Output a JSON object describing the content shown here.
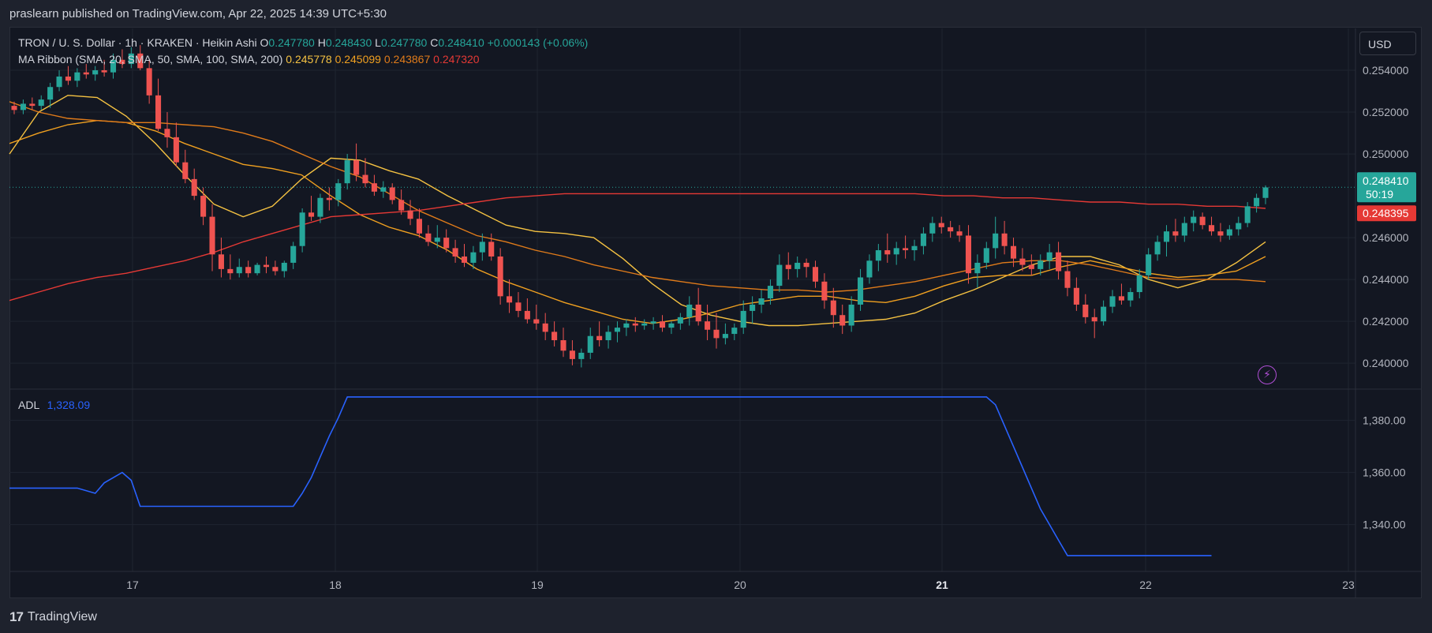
{
  "header": {
    "publisher_text": "praslearn published on TradingView.com, Apr 22, 2025 14:39 UTC+5:30"
  },
  "legend": {
    "symbol": "TRON / U. S. Dollar · 1h · KRAKEN · Heikin Ashi",
    "o_label": "O",
    "o_value": "0.247780",
    "h_label": "H",
    "h_value": "0.248430",
    "l_label": "L",
    "l_value": "0.247780",
    "c_label": "C",
    "c_value": "0.248410",
    "change": "+0.000143 (+0.06%)",
    "ma_title": "MA Ribbon (SMA, 20, SMA, 50, SMA, 100, SMA, 200)",
    "ma_values": [
      "0.245778",
      "0.245099",
      "0.243867",
      "0.247320"
    ],
    "adl_label": "ADL",
    "adl_value": "1,328.09"
  },
  "toolbar": {
    "currency_label": "USD"
  },
  "footer": {
    "brand_mark": "17",
    "brand_name": "TradingView"
  },
  "icons": {
    "bolt": "lightning-bolt-icon"
  },
  "colors": {
    "up": "#26a69a",
    "down": "#ef5350",
    "sma20": "#f5c242",
    "sma50": "#f0a020",
    "sma100": "#e07b1a",
    "sma200": "#e53935",
    "adl": "#2962ff"
  },
  "chart_data": [
    {
      "type": "candlestick",
      "title": "TRON / U. S. Dollar · 1h · KRAKEN · Heikin Ashi",
      "x_ticks": [
        "17",
        "18",
        "19",
        "20",
        "21",
        "22",
        "23"
      ],
      "y_ticks": [
        "0.254000",
        "0.252000",
        "0.250000",
        "0.246000",
        "0.244000",
        "0.242000",
        "0.240000"
      ],
      "ylim": [
        0.2388,
        0.256
      ],
      "price_label": "0.248410",
      "countdown_label": "50:19",
      "sma200_label": "0.248395",
      "last_price": 0.24841,
      "candles": [
        [
          0.2523,
          0.2525,
          0.2519,
          0.2521
        ],
        [
          0.2521,
          0.2526,
          0.2519,
          0.2524
        ],
        [
          0.2524,
          0.2527,
          0.2521,
          0.2523
        ],
        [
          0.2523,
          0.2528,
          0.2521,
          0.2526
        ],
        [
          0.2526,
          0.2534,
          0.2522,
          0.2532
        ],
        [
          0.2532,
          0.254,
          0.253,
          0.2537
        ],
        [
          0.2537,
          0.2542,
          0.2533,
          0.2535
        ],
        [
          0.2535,
          0.2541,
          0.2532,
          0.2539
        ],
        [
          0.2539,
          0.2543,
          0.2536,
          0.2538
        ],
        [
          0.2538,
          0.2542,
          0.2535,
          0.254
        ],
        [
          0.254,
          0.2545,
          0.2537,
          0.2539
        ],
        [
          0.2539,
          0.2548,
          0.2536,
          0.2545
        ],
        [
          0.2545,
          0.255,
          0.2541,
          0.2543
        ],
        [
          0.2543,
          0.2551,
          0.2541,
          0.2548
        ],
        [
          0.2548,
          0.2552,
          0.254,
          0.2541
        ],
        [
          0.2541,
          0.2545,
          0.2524,
          0.2528
        ],
        [
          0.2528,
          0.2536,
          0.2511,
          0.2512
        ],
        [
          0.2512,
          0.252,
          0.2503,
          0.2508
        ],
        [
          0.2508,
          0.2515,
          0.2494,
          0.2496
        ],
        [
          0.2496,
          0.2502,
          0.2486,
          0.2488
        ],
        [
          0.2488,
          0.2493,
          0.2478,
          0.248
        ],
        [
          0.248,
          0.2484,
          0.2466,
          0.247
        ],
        [
          0.247,
          0.2476,
          0.2444,
          0.2452
        ],
        [
          0.2452,
          0.246,
          0.2441,
          0.2445
        ],
        [
          0.2445,
          0.2452,
          0.244,
          0.2443
        ],
        [
          0.2443,
          0.245,
          0.2441,
          0.2446
        ],
        [
          0.2446,
          0.2449,
          0.2441,
          0.2443
        ],
        [
          0.2443,
          0.2448,
          0.2442,
          0.2447
        ],
        [
          0.2447,
          0.2451,
          0.2443,
          0.2446
        ],
        [
          0.2446,
          0.2449,
          0.2442,
          0.2444
        ],
        [
          0.2444,
          0.2449,
          0.2441,
          0.2448
        ],
        [
          0.2448,
          0.2458,
          0.2445,
          0.2456
        ],
        [
          0.2456,
          0.2474,
          0.2453,
          0.2472
        ],
        [
          0.2472,
          0.248,
          0.2468,
          0.247
        ],
        [
          0.247,
          0.2481,
          0.2467,
          0.2479
        ],
        [
          0.2479,
          0.2484,
          0.2473,
          0.2478
        ],
        [
          0.2478,
          0.2488,
          0.2475,
          0.2486
        ],
        [
          0.2486,
          0.25,
          0.2483,
          0.2497
        ],
        [
          0.2497,
          0.2505,
          0.2487,
          0.249
        ],
        [
          0.249,
          0.2498,
          0.2484,
          0.2486
        ],
        [
          0.2486,
          0.249,
          0.248,
          0.2482
        ],
        [
          0.2482,
          0.2487,
          0.2479,
          0.2484
        ],
        [
          0.2484,
          0.2486,
          0.2476,
          0.2478
        ],
        [
          0.2478,
          0.2483,
          0.2471,
          0.2473
        ],
        [
          0.2473,
          0.2478,
          0.2466,
          0.2469
        ],
        [
          0.2469,
          0.2474,
          0.246,
          0.2462
        ],
        [
          0.2462,
          0.2466,
          0.2456,
          0.2458
        ],
        [
          0.2458,
          0.2466,
          0.2455,
          0.246
        ],
        [
          0.246,
          0.2464,
          0.2453,
          0.2455
        ],
        [
          0.2455,
          0.2459,
          0.2448,
          0.2451
        ],
        [
          0.2451,
          0.2457,
          0.2446,
          0.2448
        ],
        [
          0.2448,
          0.2456,
          0.2445,
          0.2453
        ],
        [
          0.2453,
          0.2462,
          0.2449,
          0.2458
        ],
        [
          0.2458,
          0.2462,
          0.2449,
          0.2451
        ],
        [
          0.2451,
          0.2455,
          0.2428,
          0.2432
        ],
        [
          0.2432,
          0.244,
          0.2424,
          0.2429
        ],
        [
          0.2429,
          0.2434,
          0.2422,
          0.2425
        ],
        [
          0.2425,
          0.2431,
          0.2419,
          0.2421
        ],
        [
          0.2421,
          0.2428,
          0.2416,
          0.2419
        ],
        [
          0.2419,
          0.2424,
          0.2411,
          0.2415
        ],
        [
          0.2415,
          0.242,
          0.2408,
          0.2411
        ],
        [
          0.2411,
          0.2417,
          0.2403,
          0.2406
        ],
        [
          0.2406,
          0.2411,
          0.2399,
          0.2402
        ],
        [
          0.2402,
          0.2407,
          0.2398,
          0.2405
        ],
        [
          0.2405,
          0.2417,
          0.2402,
          0.2413
        ],
        [
          0.2413,
          0.242,
          0.2408,
          0.2411
        ],
        [
          0.2411,
          0.2418,
          0.2407,
          0.2415
        ],
        [
          0.2415,
          0.242,
          0.241,
          0.2417
        ],
        [
          0.2417,
          0.2421,
          0.2413,
          0.2419
        ],
        [
          0.2419,
          0.2422,
          0.2415,
          0.2418
        ],
        [
          0.2418,
          0.2421,
          0.2416,
          0.2419
        ],
        [
          0.2419,
          0.2422,
          0.2416,
          0.242
        ],
        [
          0.242,
          0.2423,
          0.2415,
          0.2417
        ],
        [
          0.2417,
          0.242,
          0.2414,
          0.2419
        ],
        [
          0.2419,
          0.2424,
          0.2416,
          0.2422
        ],
        [
          0.2422,
          0.2432,
          0.2418,
          0.2428
        ],
        [
          0.2428,
          0.2436,
          0.2418,
          0.242
        ],
        [
          0.242,
          0.2428,
          0.2411,
          0.2416
        ],
        [
          0.2416,
          0.2424,
          0.2407,
          0.2412
        ],
        [
          0.2412,
          0.2419,
          0.2409,
          0.2414
        ],
        [
          0.2414,
          0.2419,
          0.2411,
          0.2417
        ],
        [
          0.2417,
          0.243,
          0.2414,
          0.2425
        ],
        [
          0.2425,
          0.2432,
          0.2419,
          0.2428
        ],
        [
          0.2428,
          0.2435,
          0.2424,
          0.2431
        ],
        [
          0.2431,
          0.244,
          0.2428,
          0.2437
        ],
        [
          0.2437,
          0.2452,
          0.2434,
          0.2447
        ],
        [
          0.2447,
          0.2453,
          0.244,
          0.2445
        ],
        [
          0.2445,
          0.2451,
          0.2441,
          0.2448
        ],
        [
          0.2448,
          0.245,
          0.2441,
          0.2446
        ],
        [
          0.2446,
          0.2449,
          0.2436,
          0.2439
        ],
        [
          0.2439,
          0.2443,
          0.2426,
          0.243
        ],
        [
          0.243,
          0.2436,
          0.2417,
          0.2423
        ],
        [
          0.2423,
          0.2428,
          0.2414,
          0.2418
        ],
        [
          0.2418,
          0.2432,
          0.2415,
          0.2428
        ],
        [
          0.2428,
          0.2445,
          0.2425,
          0.2441
        ],
        [
          0.2441,
          0.2452,
          0.2438,
          0.2449
        ],
        [
          0.2449,
          0.2457,
          0.2444,
          0.2454
        ],
        [
          0.2454,
          0.2462,
          0.2448,
          0.2452
        ],
        [
          0.2452,
          0.2458,
          0.2447,
          0.2455
        ],
        [
          0.2455,
          0.2461,
          0.245,
          0.2454
        ],
        [
          0.2454,
          0.2459,
          0.2449,
          0.2456
        ],
        [
          0.2456,
          0.2465,
          0.2452,
          0.2462
        ],
        [
          0.2462,
          0.247,
          0.2458,
          0.2467
        ],
        [
          0.2467,
          0.247,
          0.2462,
          0.2465
        ],
        [
          0.2465,
          0.2468,
          0.246,
          0.2463
        ],
        [
          0.2463,
          0.2466,
          0.2458,
          0.2461
        ],
        [
          0.2461,
          0.2466,
          0.2438,
          0.2443
        ],
        [
          0.2443,
          0.2452,
          0.2436,
          0.2448
        ],
        [
          0.2448,
          0.2458,
          0.2445,
          0.2455
        ],
        [
          0.2455,
          0.247,
          0.245,
          0.2462
        ],
        [
          0.2462,
          0.2468,
          0.2452,
          0.2456
        ],
        [
          0.2456,
          0.246,
          0.2446,
          0.245
        ],
        [
          0.245,
          0.2455,
          0.2444,
          0.2447
        ],
        [
          0.2447,
          0.2452,
          0.2442,
          0.2445
        ],
        [
          0.2445,
          0.2452,
          0.2442,
          0.2449
        ],
        [
          0.2449,
          0.2457,
          0.2445,
          0.2453
        ],
        [
          0.2453,
          0.2458,
          0.244,
          0.2444
        ],
        [
          0.2444,
          0.2449,
          0.2432,
          0.2436
        ],
        [
          0.2436,
          0.2441,
          0.2425,
          0.2428
        ],
        [
          0.2428,
          0.2433,
          0.2419,
          0.2422
        ],
        [
          0.2422,
          0.2426,
          0.2412,
          0.242
        ],
        [
          0.242,
          0.243,
          0.2418,
          0.2427
        ],
        [
          0.2427,
          0.2435,
          0.2424,
          0.2432
        ],
        [
          0.2432,
          0.2438,
          0.2428,
          0.243
        ],
        [
          0.243,
          0.2436,
          0.2427,
          0.2434
        ],
        [
          0.2434,
          0.2445,
          0.2431,
          0.2442
        ],
        [
          0.2442,
          0.2455,
          0.244,
          0.2452
        ],
        [
          0.2452,
          0.2461,
          0.2449,
          0.2458
        ],
        [
          0.2458,
          0.2466,
          0.2451,
          0.2463
        ],
        [
          0.2463,
          0.2469,
          0.2458,
          0.2461
        ],
        [
          0.2461,
          0.247,
          0.2458,
          0.2467
        ],
        [
          0.2467,
          0.2473,
          0.2463,
          0.247
        ],
        [
          0.247,
          0.2472,
          0.2464,
          0.2466
        ],
        [
          0.2466,
          0.247,
          0.2461,
          0.2463
        ],
        [
          0.2463,
          0.2467,
          0.2458,
          0.2461
        ],
        [
          0.2461,
          0.2466,
          0.2459,
          0.2464
        ],
        [
          0.2464,
          0.247,
          0.2461,
          0.2467
        ],
        [
          0.2467,
          0.2477,
          0.2465,
          0.2475
        ],
        [
          0.2475,
          0.2481,
          0.2472,
          0.2479
        ],
        [
          0.2479,
          0.2485,
          0.2476,
          0.2484
        ]
      ],
      "ma_ribbon": {
        "sma20": [
          0.25,
          0.252,
          0.2528,
          0.2527,
          0.2518,
          0.2505,
          0.249,
          0.2476,
          0.247,
          0.2475,
          0.2488,
          0.2498,
          0.2497,
          0.2492,
          0.2488,
          0.248,
          0.2473,
          0.2466,
          0.2463,
          0.2462,
          0.246,
          0.245,
          0.2438,
          0.2428,
          0.2423,
          0.242,
          0.2418,
          0.2418,
          0.2419,
          0.242,
          0.2421,
          0.2424,
          0.243,
          0.2435,
          0.2441,
          0.2447,
          0.2451,
          0.2451,
          0.2447,
          0.244,
          0.2436,
          0.244,
          0.2448,
          0.2458
        ],
        "sma50": [
          0.2505,
          0.251,
          0.2514,
          0.2516,
          0.2515,
          0.2511,
          0.2505,
          0.25,
          0.2495,
          0.2493,
          0.249,
          0.248,
          0.2471,
          0.2465,
          0.2461,
          0.2454,
          0.2445,
          0.2439,
          0.2434,
          0.2429,
          0.2425,
          0.2421,
          0.2419,
          0.2421,
          0.2424,
          0.2428,
          0.243,
          0.2432,
          0.2432,
          0.243,
          0.2429,
          0.2432,
          0.2437,
          0.2441,
          0.2442,
          0.2442,
          0.2446,
          0.2449,
          0.2446,
          0.2443,
          0.2441,
          0.2442,
          0.2444,
          0.2451
        ],
        "sma100": [
          0.2525,
          0.252,
          0.2517,
          0.2516,
          0.2515,
          0.2515,
          0.2514,
          0.2513,
          0.251,
          0.2506,
          0.25,
          0.2494,
          0.2489,
          0.2481,
          0.2473,
          0.2467,
          0.2461,
          0.2458,
          0.2454,
          0.2451,
          0.2447,
          0.2444,
          0.2441,
          0.2439,
          0.2437,
          0.2436,
          0.2435,
          0.2435,
          0.2434,
          0.2435,
          0.2437,
          0.2439,
          0.2442,
          0.2445,
          0.2448,
          0.2449,
          0.2449,
          0.2447,
          0.2444,
          0.2441,
          0.244,
          0.244,
          0.244,
          0.2439
        ],
        "sma200": [
          0.243,
          0.2434,
          0.2438,
          0.2441,
          0.2443,
          0.2446,
          0.2449,
          0.2453,
          0.2458,
          0.2462,
          0.2466,
          0.247,
          0.2471,
          0.2472,
          0.2473,
          0.2475,
          0.2477,
          0.2479,
          0.248,
          0.2481,
          0.2481,
          0.2481,
          0.2481,
          0.2481,
          0.2481,
          0.2481,
          0.2481,
          0.2481,
          0.2481,
          0.2481,
          0.2481,
          0.2481,
          0.248,
          0.248,
          0.2479,
          0.2479,
          0.2478,
          0.2477,
          0.2477,
          0.2476,
          0.2476,
          0.2475,
          0.2475,
          0.2474
        ]
      }
    },
    {
      "type": "line",
      "title": "ADL",
      "y_ticks": [
        "1,380.00",
        "1,360.00",
        "1,340.00"
      ],
      "ylim": [
        1322,
        1392
      ],
      "x": [
        0,
        7,
        9,
        10,
        11,
        12,
        13,
        14,
        31,
        32,
        33,
        34,
        35,
        36,
        37,
        108,
        109,
        110,
        111,
        112,
        113,
        114,
        115,
        116,
        117,
        118,
        133
      ],
      "values": [
        1354,
        1354,
        1352,
        1356,
        1358,
        1360,
        1357,
        1347,
        1347,
        1352,
        1358,
        1366,
        1374,
        1381,
        1389,
        1389,
        1386,
        1378,
        1370,
        1362,
        1354,
        1346,
        1340,
        1334,
        1328.09,
        1328.09,
        1328.09
      ]
    }
  ]
}
